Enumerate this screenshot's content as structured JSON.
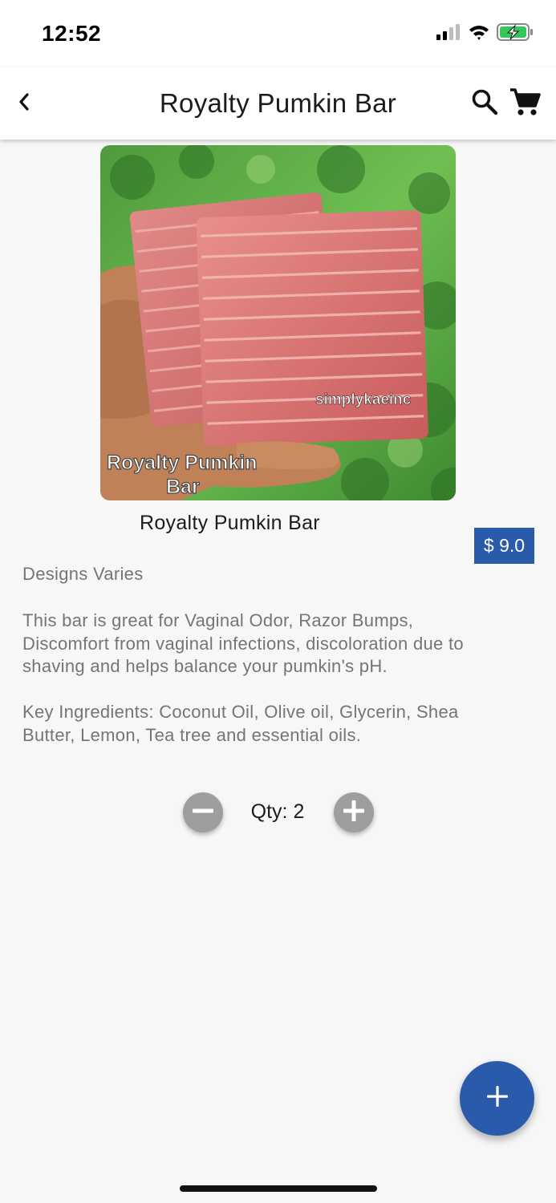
{
  "status_bar": {
    "time": "12:52",
    "icons": [
      "cellular-signal-icon",
      "wifi-icon",
      "battery-charging-icon"
    ]
  },
  "app_bar": {
    "title": "Royalty Pumkin Bar",
    "back_icon": "chevron-left-icon",
    "search_icon": "search-icon",
    "cart_icon": "shopping-cart-icon"
  },
  "product": {
    "image": {
      "watermark": "simplykaeinc",
      "caption_line1": "Royalty Pumkin",
      "caption_line2": "Bar"
    },
    "name": "Royalty Pumkin Bar",
    "price": "$ 9.0",
    "subtitle": "Designs Varies",
    "description": "This bar is great for Vaginal Odor, Razor Bumps, Discomfort from vaginal infections, discoloration due to shaving and helps balance your pumkin's pH.\n\nKey Ingredients: Coconut Oil, Olive oil, Glycerin, Shea Butter, Lemon, Tea tree and  essential oils."
  },
  "quantity": {
    "label": "Qty: 2",
    "value": 2,
    "decrement_icon": "minus-circle-icon",
    "increment_icon": "plus-circle-icon"
  },
  "fab": {
    "icon": "plus-icon"
  },
  "colors": {
    "accent": "#2a5bab",
    "background": "#f7f7f8",
    "secondary_text": "#757575",
    "stepper": "#9e9e9e",
    "battery": "#34c759"
  }
}
